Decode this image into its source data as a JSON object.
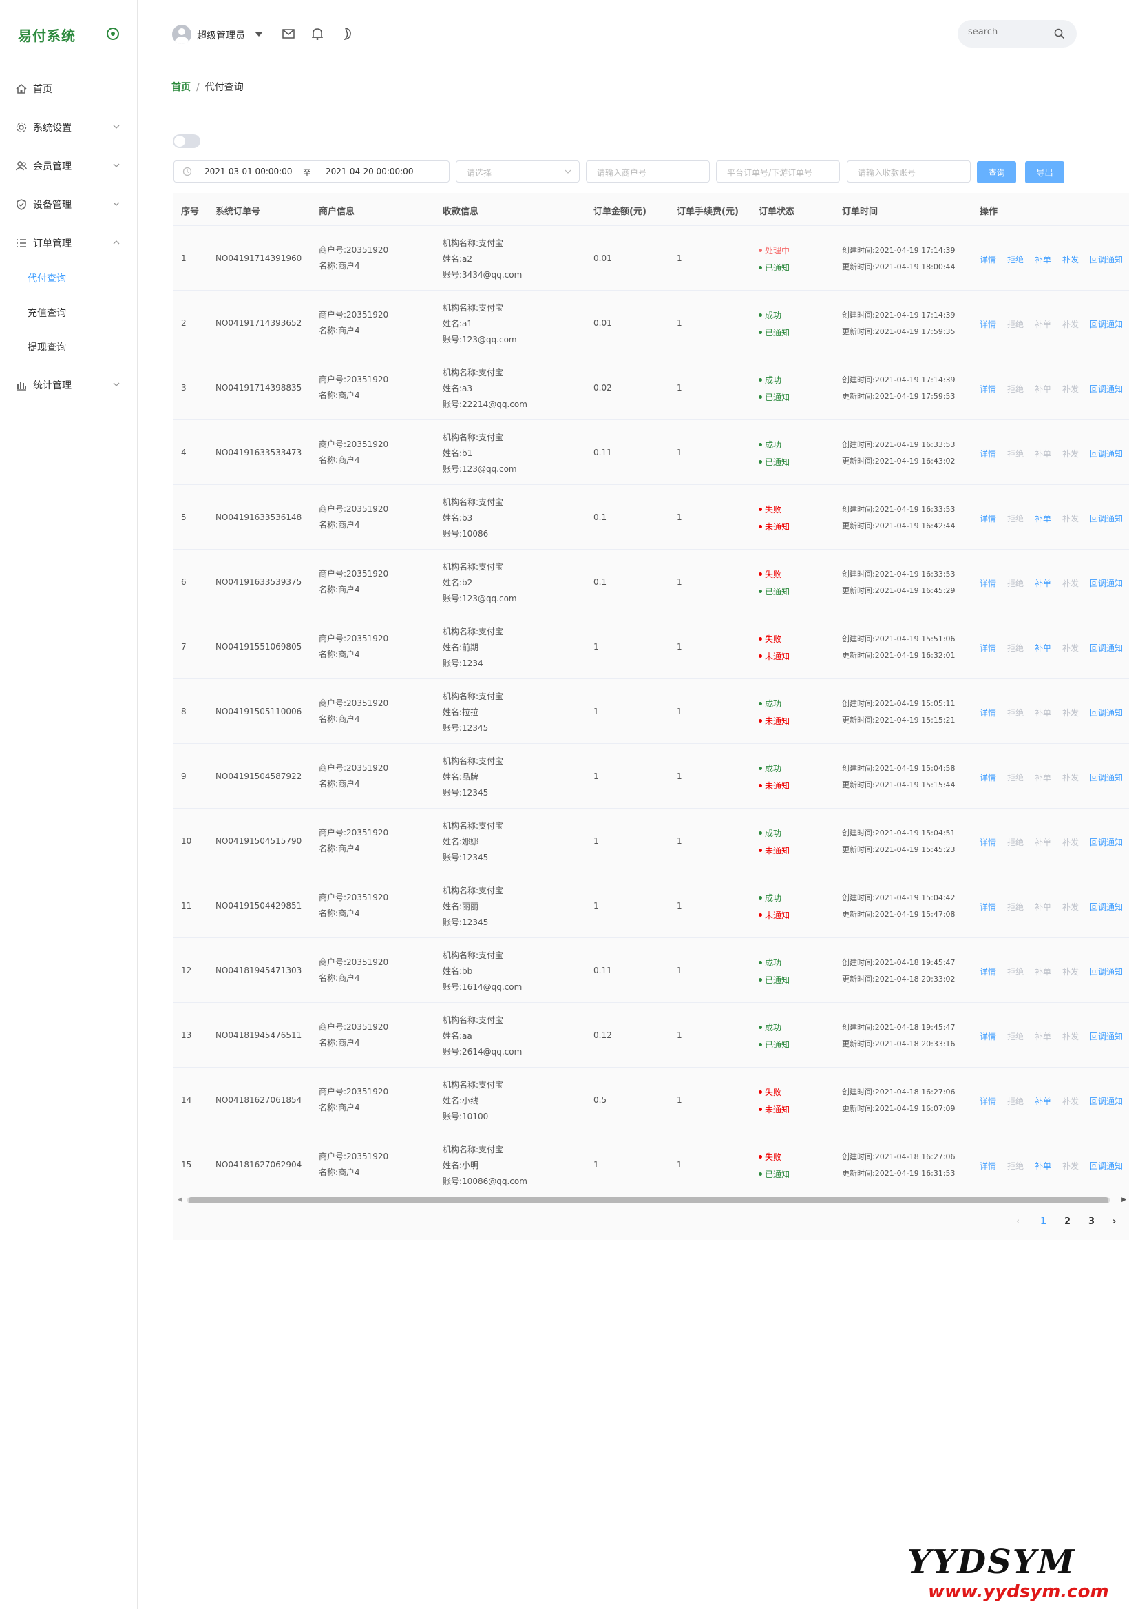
{
  "app": {
    "title": "易付系统"
  },
  "sidebar": {
    "items": [
      {
        "label": "首页",
        "icon": "home-icon"
      },
      {
        "label": "系统设置",
        "icon": "gear-icon"
      },
      {
        "label": "会员管理",
        "icon": "users-icon"
      },
      {
        "label": "设备管理",
        "icon": "shield-icon"
      },
      {
        "label": "订单管理",
        "icon": "list-icon"
      },
      {
        "label": "统计管理",
        "icon": "bar-chart-icon"
      }
    ],
    "subitems": [
      {
        "label": "代付查询",
        "active": true
      },
      {
        "label": "充值查询",
        "active": false
      },
      {
        "label": "提现查询",
        "active": false
      }
    ]
  },
  "header": {
    "user": "超级管理员",
    "search_placeholder": "search"
  },
  "breadcrumb": {
    "home": "首页",
    "separator": "/",
    "current": "代付查询"
  },
  "filters": {
    "date_start": "2021-03-01 00:00:00",
    "date_sep": "至",
    "date_end": "2021-04-20 00:00:00",
    "select_placeholder": "请选择",
    "merchant_placeholder": "请输入商户号",
    "order_placeholder": "平台订单号/下游订单号",
    "account_placeholder": "请输入收款账号",
    "query_label": "查询",
    "export_label": "导出"
  },
  "table": {
    "headers": [
      "序号",
      "系统订单号",
      "商户信息",
      "收款信息",
      "订单金额(元)",
      "订单手续费(元)",
      "订单状态",
      "订单时间",
      "操作"
    ],
    "actions": [
      "详情",
      "拒绝",
      "补单",
      "补发",
      "回调通知"
    ],
    "rows": [
      {
        "seq": "1",
        "order": "NO04191714391960",
        "merchant": "商户号:20351920",
        "merchant_name": "名称:商户4",
        "org": "机构名称:支付宝",
        "name": "姓名:a2",
        "account": "账号:3434@qq.com",
        "amount": "0.01",
        "fee": "1",
        "status": "处理中",
        "status_type": "proc",
        "notify": "已通知",
        "notify_type": "notified",
        "created": "创建时间:2021-04-19 17:14:39",
        "updated": "更新时间:2021-04-19 18:00:44",
        "enabled": [
          true,
          true,
          true,
          true,
          true
        ]
      },
      {
        "seq": "2",
        "order": "NO04191714393652",
        "merchant": "商户号:20351920",
        "merchant_name": "名称:商户4",
        "org": "机构名称:支付宝",
        "name": "姓名:a1",
        "account": "账号:123@qq.com",
        "amount": "0.01",
        "fee": "1",
        "status": "成功",
        "status_type": "ok",
        "notify": "已通知",
        "notify_type": "notified",
        "created": "创建时间:2021-04-19 17:14:39",
        "updated": "更新时间:2021-04-19 17:59:35",
        "enabled": [
          true,
          false,
          false,
          false,
          true
        ]
      },
      {
        "seq": "3",
        "order": "NO04191714398835",
        "merchant": "商户号:20351920",
        "merchant_name": "名称:商户4",
        "org": "机构名称:支付宝",
        "name": "姓名:a3",
        "account": "账号:22214@qq.com",
        "amount": "0.02",
        "fee": "1",
        "status": "成功",
        "status_type": "ok",
        "notify": "已通知",
        "notify_type": "notified",
        "created": "创建时间:2021-04-19 17:14:39",
        "updated": "更新时间:2021-04-19 17:59:53",
        "enabled": [
          true,
          false,
          false,
          false,
          true
        ]
      },
      {
        "seq": "4",
        "order": "NO04191633533473",
        "merchant": "商户号:20351920",
        "merchant_name": "名称:商户4",
        "org": "机构名称:支付宝",
        "name": "姓名:b1",
        "account": "账号:123@qq.com",
        "amount": "0.11",
        "fee": "1",
        "status": "成功",
        "status_type": "ok",
        "notify": "已通知",
        "notify_type": "notified",
        "created": "创建时间:2021-04-19 16:33:53",
        "updated": "更新时间:2021-04-19 16:43:02",
        "enabled": [
          true,
          false,
          false,
          false,
          true
        ]
      },
      {
        "seq": "5",
        "order": "NO04191633536148",
        "merchant": "商户号:20351920",
        "merchant_name": "名称:商户4",
        "org": "机构名称:支付宝",
        "name": "姓名:b3",
        "account": "账号:10086",
        "amount": "0.1",
        "fee": "1",
        "status": "失败",
        "status_type": "fail",
        "notify": "未通知",
        "notify_type": "notok",
        "created": "创建时间:2021-04-19 16:33:53",
        "updated": "更新时间:2021-04-19 16:42:44",
        "enabled": [
          true,
          false,
          true,
          false,
          true
        ]
      },
      {
        "seq": "6",
        "order": "NO04191633539375",
        "merchant": "商户号:20351920",
        "merchant_name": "名称:商户4",
        "org": "机构名称:支付宝",
        "name": "姓名:b2",
        "account": "账号:123@qq.com",
        "amount": "0.1",
        "fee": "1",
        "status": "失败",
        "status_type": "fail",
        "notify": "已通知",
        "notify_type": "notified",
        "created": "创建时间:2021-04-19 16:33:53",
        "updated": "更新时间:2021-04-19 16:45:29",
        "enabled": [
          true,
          false,
          true,
          false,
          true
        ]
      },
      {
        "seq": "7",
        "order": "NO04191551069805",
        "merchant": "商户号:20351920",
        "merchant_name": "名称:商户4",
        "org": "机构名称:支付宝",
        "name": "姓名:前期",
        "account": "账号:1234",
        "amount": "1",
        "fee": "1",
        "status": "失败",
        "status_type": "fail",
        "notify": "未通知",
        "notify_type": "notok",
        "created": "创建时间:2021-04-19 15:51:06",
        "updated": "更新时间:2021-04-19 16:32:01",
        "enabled": [
          true,
          false,
          true,
          false,
          true
        ]
      },
      {
        "seq": "8",
        "order": "NO04191505110006",
        "merchant": "商户号:20351920",
        "merchant_name": "名称:商户4",
        "org": "机构名称:支付宝",
        "name": "姓名:拉拉",
        "account": "账号:12345",
        "amount": "1",
        "fee": "1",
        "status": "成功",
        "status_type": "ok",
        "notify": "未通知",
        "notify_type": "notok",
        "created": "创建时间:2021-04-19 15:05:11",
        "updated": "更新时间:2021-04-19 15:15:21",
        "enabled": [
          true,
          false,
          false,
          false,
          true
        ]
      },
      {
        "seq": "9",
        "order": "NO04191504587922",
        "merchant": "商户号:20351920",
        "merchant_name": "名称:商户4",
        "org": "机构名称:支付宝",
        "name": "姓名:品牌",
        "account": "账号:12345",
        "amount": "1",
        "fee": "1",
        "status": "成功",
        "status_type": "ok",
        "notify": "未通知",
        "notify_type": "notok",
        "created": "创建时间:2021-04-19 15:04:58",
        "updated": "更新时间:2021-04-19 15:15:44",
        "enabled": [
          true,
          false,
          false,
          false,
          true
        ]
      },
      {
        "seq": "10",
        "order": "NO04191504515790",
        "merchant": "商户号:20351920",
        "merchant_name": "名称:商户4",
        "org": "机构名称:支付宝",
        "name": "姓名:娜娜",
        "account": "账号:12345",
        "amount": "1",
        "fee": "1",
        "status": "成功",
        "status_type": "ok",
        "notify": "未通知",
        "notify_type": "notok",
        "created": "创建时间:2021-04-19 15:04:51",
        "updated": "更新时间:2021-04-19 15:45:23",
        "enabled": [
          true,
          false,
          false,
          false,
          true
        ]
      },
      {
        "seq": "11",
        "order": "NO04191504429851",
        "merchant": "商户号:20351920",
        "merchant_name": "名称:商户4",
        "org": "机构名称:支付宝",
        "name": "姓名:丽丽",
        "account": "账号:12345",
        "amount": "1",
        "fee": "1",
        "status": "成功",
        "status_type": "ok",
        "notify": "未通知",
        "notify_type": "notok",
        "created": "创建时间:2021-04-19 15:04:42",
        "updated": "更新时间:2021-04-19 15:47:08",
        "enabled": [
          true,
          false,
          false,
          false,
          true
        ]
      },
      {
        "seq": "12",
        "order": "NO04181945471303",
        "merchant": "商户号:20351920",
        "merchant_name": "名称:商户4",
        "org": "机构名称:支付宝",
        "name": "姓名:bb",
        "account": "账号:1614@qq.com",
        "amount": "0.11",
        "fee": "1",
        "status": "成功",
        "status_type": "ok",
        "notify": "已通知",
        "notify_type": "notified",
        "created": "创建时间:2021-04-18 19:45:47",
        "updated": "更新时间:2021-04-18 20:33:02",
        "enabled": [
          true,
          false,
          false,
          false,
          true
        ]
      },
      {
        "seq": "13",
        "order": "NO04181945476511",
        "merchant": "商户号:20351920",
        "merchant_name": "名称:商户4",
        "org": "机构名称:支付宝",
        "name": "姓名:aa",
        "account": "账号:2614@qq.com",
        "amount": "0.12",
        "fee": "1",
        "status": "成功",
        "status_type": "ok",
        "notify": "已通知",
        "notify_type": "notified",
        "created": "创建时间:2021-04-18 19:45:47",
        "updated": "更新时间:2021-04-18 20:33:16",
        "enabled": [
          true,
          false,
          false,
          false,
          true
        ]
      },
      {
        "seq": "14",
        "order": "NO04181627061854",
        "merchant": "商户号:20351920",
        "merchant_name": "名称:商户4",
        "org": "机构名称:支付宝",
        "name": "姓名:小线",
        "account": "账号:10100",
        "amount": "0.5",
        "fee": "1",
        "status": "失败",
        "status_type": "fail",
        "notify": "未通知",
        "notify_type": "notok",
        "created": "创建时间:2021-04-18 16:27:06",
        "updated": "更新时间:2021-04-19 16:07:09",
        "enabled": [
          true,
          false,
          true,
          false,
          true
        ]
      },
      {
        "seq": "15",
        "order": "NO04181627062904",
        "merchant": "商户号:20351920",
        "merchant_name": "名称:商户4",
        "org": "机构名称:支付宝",
        "name": "姓名:小明",
        "account": "账号:10086@qq.com",
        "amount": "1",
        "fee": "1",
        "status": "失败",
        "status_type": "fail",
        "notify": "已通知",
        "notify_type": "notified",
        "created": "创建时间:2021-04-18 16:27:06",
        "updated": "更新时间:2021-04-19 16:31:53",
        "enabled": [
          true,
          false,
          true,
          false,
          true
        ]
      }
    ]
  },
  "pagination": {
    "prev": "‹",
    "pages": [
      "1",
      "2",
      "3"
    ],
    "current": "1",
    "next": "›"
  },
  "watermark": {
    "big": "YYDSYM",
    "url": "www.yydsym.com"
  }
}
